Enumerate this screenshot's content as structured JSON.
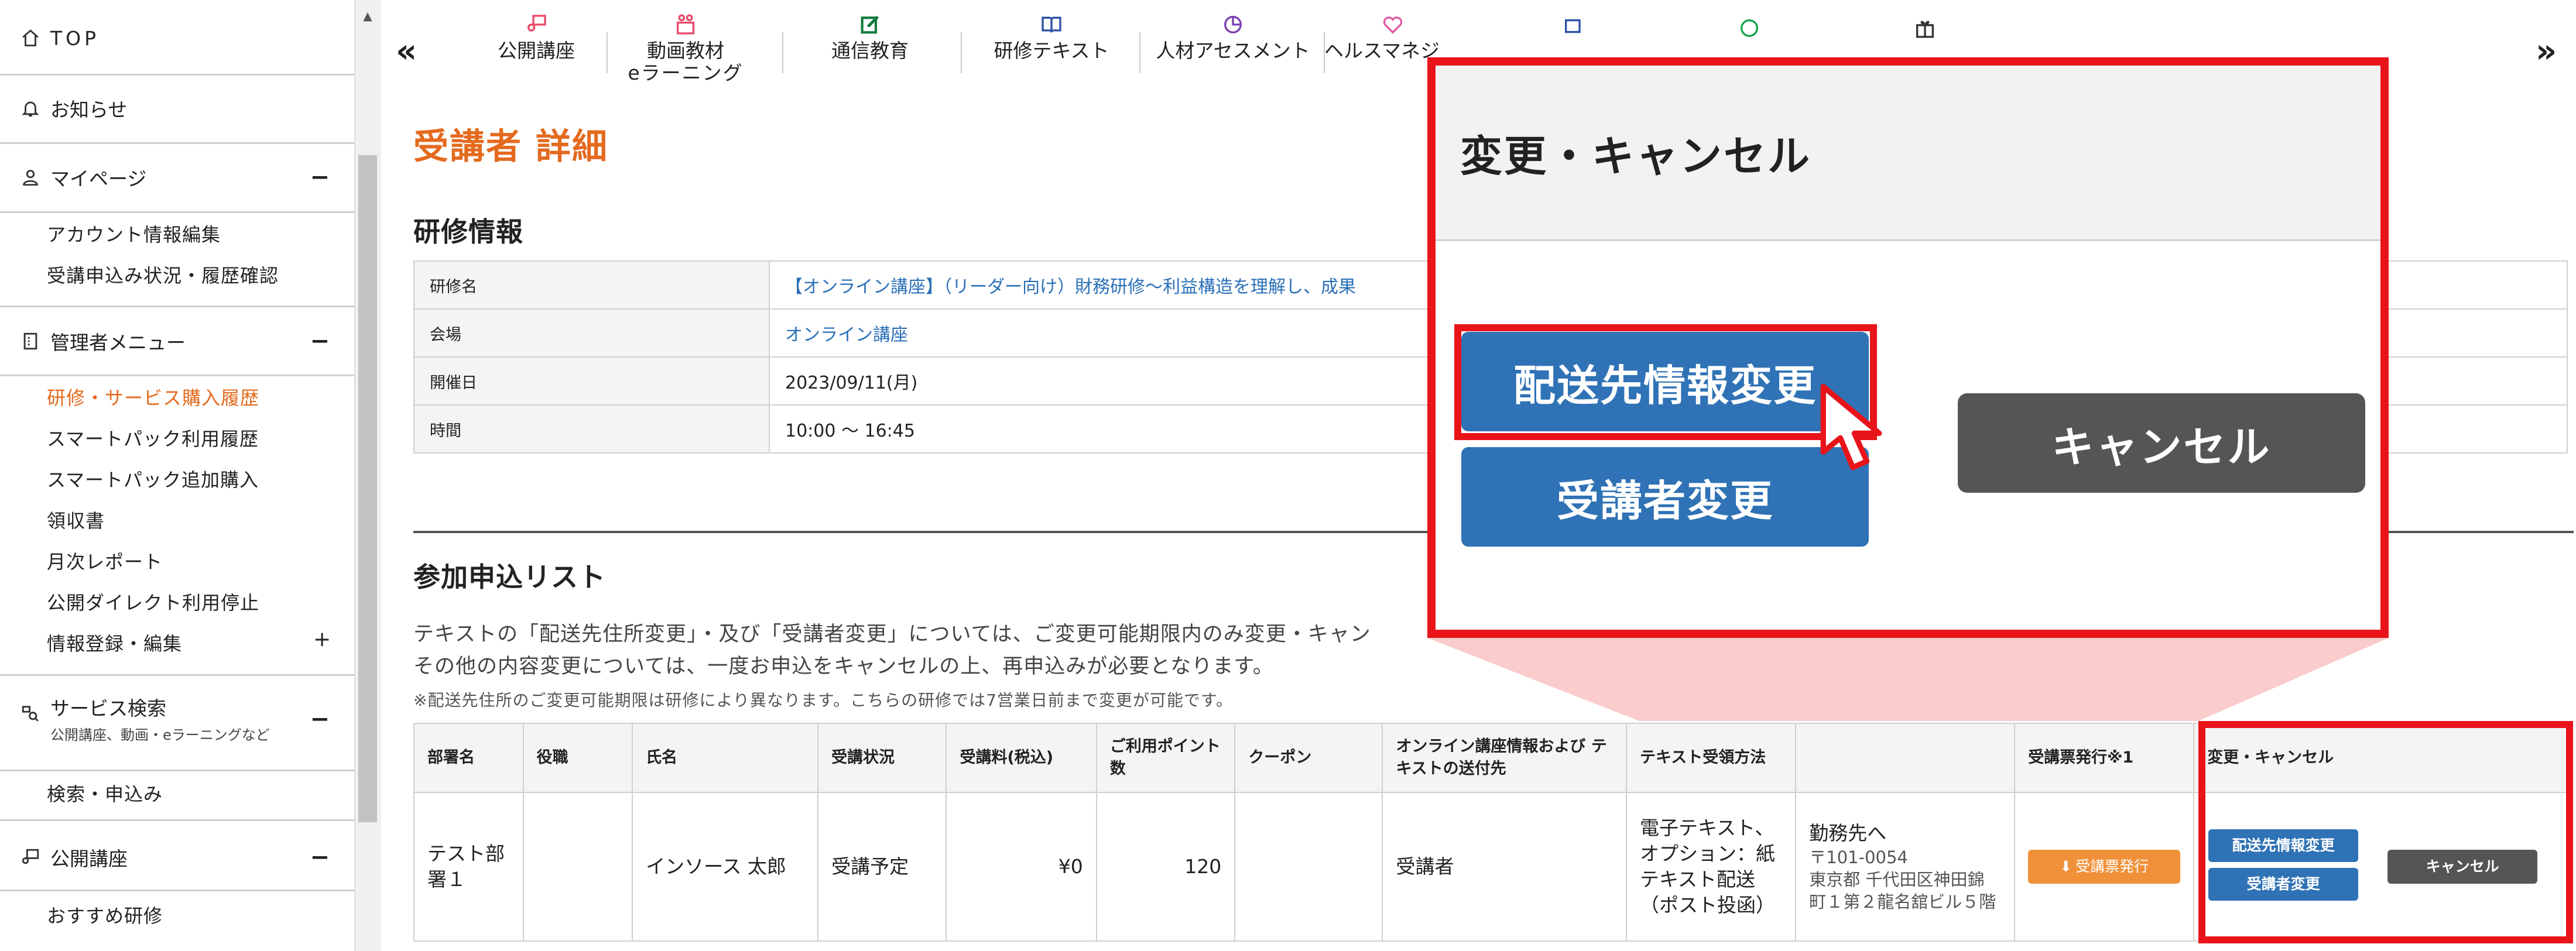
{
  "sidebar": {
    "top_label": "TOP",
    "news_label": "お知らせ",
    "mypage_label": "マイページ",
    "mypage_toggle": "−",
    "mypage_items": [
      "アカウント情報編集",
      "受講申込み状況・履歴確認"
    ],
    "admin_label": "管理者メニュー",
    "admin_toggle": "−",
    "admin_items": [
      {
        "label": "研修・サービス購入履歴",
        "active": true
      },
      {
        "label": "スマートパック利用履歴",
        "active": false
      },
      {
        "label": "スマートパック追加購入",
        "active": false
      },
      {
        "label": "領収書",
        "active": false
      },
      {
        "label": "月次レポート",
        "active": false
      },
      {
        "label": "公開ダイレクト利用停止",
        "active": false
      },
      {
        "label": "情報登録・編集",
        "active": false
      }
    ],
    "info_toggle": "+",
    "service_search_label": "サービス検索",
    "service_search_sub": "公開講座、動画・eラーニングなど",
    "service_toggle": "−",
    "search_apply": "検索・申込み",
    "public_course_label": "公開講座",
    "public_toggle": "−",
    "recommended": "おすすめ研修"
  },
  "topnav": {
    "prev": "«",
    "next": "»",
    "items": [
      {
        "l1": "公開講座",
        "l2": "",
        "icon": "public-course-icon"
      },
      {
        "l1": "動画教材",
        "l2": "eラーニング",
        "icon": "video-icon"
      },
      {
        "l1": "通信教育",
        "l2": "",
        "icon": "correspondence-icon"
      },
      {
        "l1": "研修テキスト",
        "l2": "",
        "icon": "book-icon"
      },
      {
        "l1": "人材アセスメント",
        "l2": "",
        "icon": "assessment-icon"
      },
      {
        "l1": "ヘルスマネジ",
        "l2": "",
        "icon": "heart-icon"
      }
    ]
  },
  "main": {
    "title": "受講者 詳細",
    "training_section": "研修情報",
    "training_info": [
      {
        "label": "研修名",
        "value": "【オンライン講座】（リーダー向け）財務研修～利益構造を理解し、成果",
        "link": true
      },
      {
        "label": "会場",
        "value": "オンライン講座",
        "link": true
      },
      {
        "label": "開催日",
        "value": "2023/09/11(月)",
        "link": false
      },
      {
        "label": "時間",
        "value": "10:00 ～ 16:45",
        "link": false
      }
    ],
    "list_section": "参加申込リスト",
    "note1": "テキストの「配送先住所変更」・及び「受講者変更」については、ご変更可能期限内のみ変更・キャン",
    "note2": "その他の内容変更については、一度お申込をキャンセルの上、再申込みが必要となります。",
    "note3": "※配送先住所のご変更可能期限は研修により異なります。こちらの研修では7営業日前まで変更が可能です。"
  },
  "list_table": {
    "headers": [
      "部署名",
      "役職",
      "氏名",
      "受講状況",
      "受講料(税込)",
      "ご利用ポイント数",
      "クーポン",
      "オンライン講座情報および テキストの送付先",
      "テキスト受領方法",
      "",
      "受講票発行※1",
      "変更・キャンセル"
    ],
    "row": {
      "dept": "テスト部署１",
      "position": "",
      "name": "インソース 太郎",
      "status": "受講予定",
      "fee": "¥0",
      "points": "120",
      "coupon": "",
      "dest": "受講者",
      "receive_method": "電子テキスト、オプション：紙テキスト配送（ポスト投函）",
      "addr_title": "勤務先へ",
      "addr_zip": "〒101-0054",
      "addr_line": "東京都 千代田区神田錦町１第２龍名舘ビル５階",
      "ticket_btn": "受講票発行",
      "change_btn": "配送先情報変更",
      "participant_btn": "受講者変更",
      "cancel_btn": "キャンセル"
    }
  },
  "zoom": {
    "title": "変更・キャンセル",
    "change_btn": "配送先情報変更",
    "participant_btn": "受講者変更",
    "cancel_btn": "キャンセル"
  },
  "colors": {
    "accent": "#e46a1e",
    "highlight": "#e8141a",
    "button_blue": "#2f72b5",
    "button_gray": "#555555",
    "button_orange": "#f0913a"
  }
}
